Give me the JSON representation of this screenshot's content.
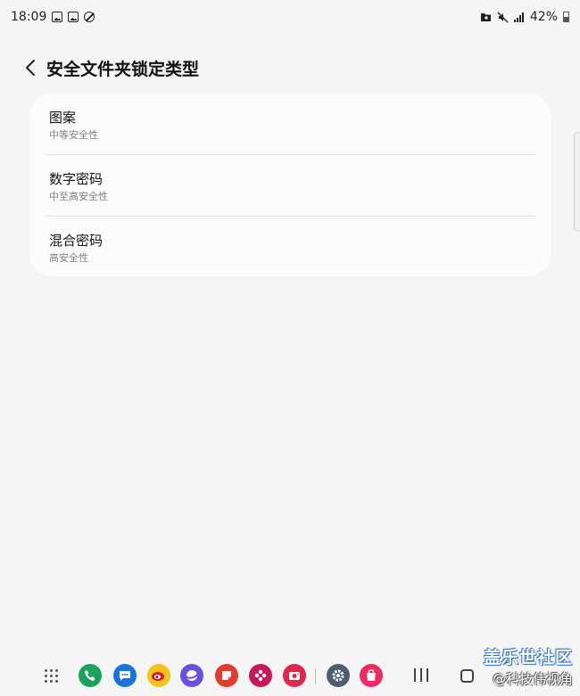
{
  "status_bar": {
    "time": "18:09",
    "battery": "42%"
  },
  "header": {
    "title": "安全文件夹锁定类型"
  },
  "options": [
    {
      "title": "图案",
      "subtitle": "中等安全性"
    },
    {
      "title": "数字密码",
      "subtitle": "中至高安全性"
    },
    {
      "title": "混合密码",
      "subtitle": "高安全性"
    }
  ],
  "watermark": {
    "logo": "盖乐世社区",
    "handle": "@科技伟视角"
  },
  "colors": {
    "background": "#f5f5f5",
    "card": "#fcfcfc",
    "subtitle": "#808080"
  },
  "taskbar_apps": [
    "apps-grid-icon",
    "phone-icon",
    "messages-icon",
    "weibo-icon",
    "internet-icon",
    "notes-icon",
    "flower-icon",
    "camera-icon",
    "settings-icon",
    "store-icon"
  ]
}
